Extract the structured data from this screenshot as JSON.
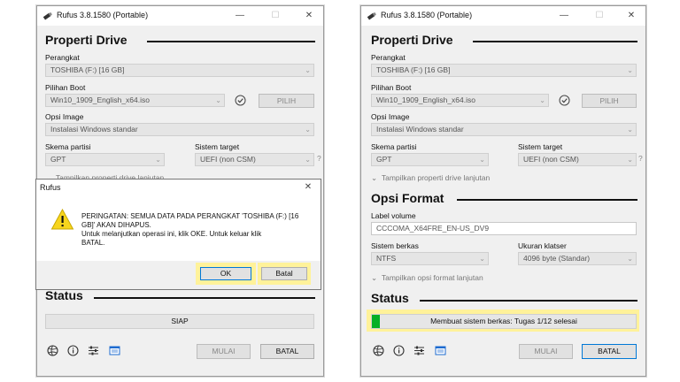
{
  "left": {
    "title": "Rufus 3.8.1580 (Portable)",
    "drive_section": "Properti Drive",
    "device_label": "Perangkat",
    "device_value": "TOSHIBA (F:) [16 GB]",
    "boot_label": "Pilihan Boot",
    "boot_value": "Win10_1909_English_x64.iso",
    "select_button": "PILIH",
    "image_label": "Opsi Image",
    "image_value": "Instalasi Windows standar",
    "partition_label": "Skema partisi",
    "partition_value": "GPT",
    "target_label": "Sistem target",
    "target_value": "UEFI (non CSM)",
    "help_mark": "?",
    "advanced_drive": "Tampilkan properti drive lanjutan",
    "status_section": "Status",
    "status_text": "SIAP",
    "start_button": "MULAI",
    "cancel_button": "BATAL"
  },
  "dialog": {
    "title": "Rufus",
    "message_line1": "PERINGATAN: SEMUA DATA PADA PERANGKAT 'TOSHIBA (F:) [16",
    "message_line2": "GB]' AKAN DIHAPUS.",
    "message_line3": "Untuk melanjutkan operasi ini, klik OKE. Untuk keluar klik",
    "message_line4": "BATAL.",
    "ok_button": "OK",
    "cancel_button": "Batal"
  },
  "right": {
    "title": "Rufus 3.8.1580 (Portable)",
    "drive_section": "Properti Drive",
    "device_label": "Perangkat",
    "device_value": "TOSHIBA (F:) [16 GB]",
    "boot_label": "Pilihan Boot",
    "boot_value": "Win10_1909_English_x64.iso",
    "select_button": "PILIH",
    "image_label": "Opsi Image",
    "image_value": "Instalasi Windows standar",
    "partition_label": "Skema partisi",
    "partition_value": "GPT",
    "target_label": "Sistem target",
    "target_value": "UEFI (non CSM)",
    "help_mark": "?",
    "advanced_drive": "Tampilkan properti drive lanjutan",
    "format_section": "Opsi Format",
    "volume_label": "Label volume",
    "volume_value": "CCCOMA_X64FRE_EN-US_DV9",
    "fs_label": "Sistem berkas",
    "fs_value": "NTFS",
    "cluster_label": "Ukuran klatser",
    "cluster_value": "4096 byte (Standar)",
    "advanced_format": "Tampilkan opsi format lanjutan",
    "status_section": "Status",
    "status_text": "Membuat sistem berkas: Tugas 1/12 selesai",
    "progress_fraction": 0.03,
    "start_button": "MULAI",
    "cancel_button": "BATAL"
  },
  "colors": {
    "highlight": "#fff29a",
    "progress": "#06b025",
    "focus_border": "#0078d7",
    "warning": "#f7d51d"
  }
}
